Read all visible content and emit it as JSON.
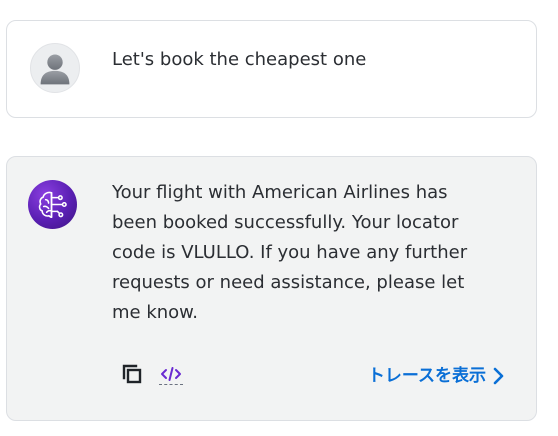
{
  "conversation": {
    "user_message": {
      "avatar_icon": "user-avatar-icon",
      "text": "Let's book the cheapest one"
    },
    "assistant_message": {
      "avatar_icon": "ai-brain-icon",
      "avatar_color": "#6a2bd1",
      "text": "Your flight with American Airlines has been booked successfully. Your locator code is VLULLO. If you have any further requests or need assistance, please let me know.",
      "actions": {
        "copy_icon": "copy-icon",
        "code_icon": "code-icon",
        "trace_label": "トレースを表示",
        "trace_icon": "chevron-right-icon",
        "trace_color": "#0a6fd6"
      }
    }
  }
}
